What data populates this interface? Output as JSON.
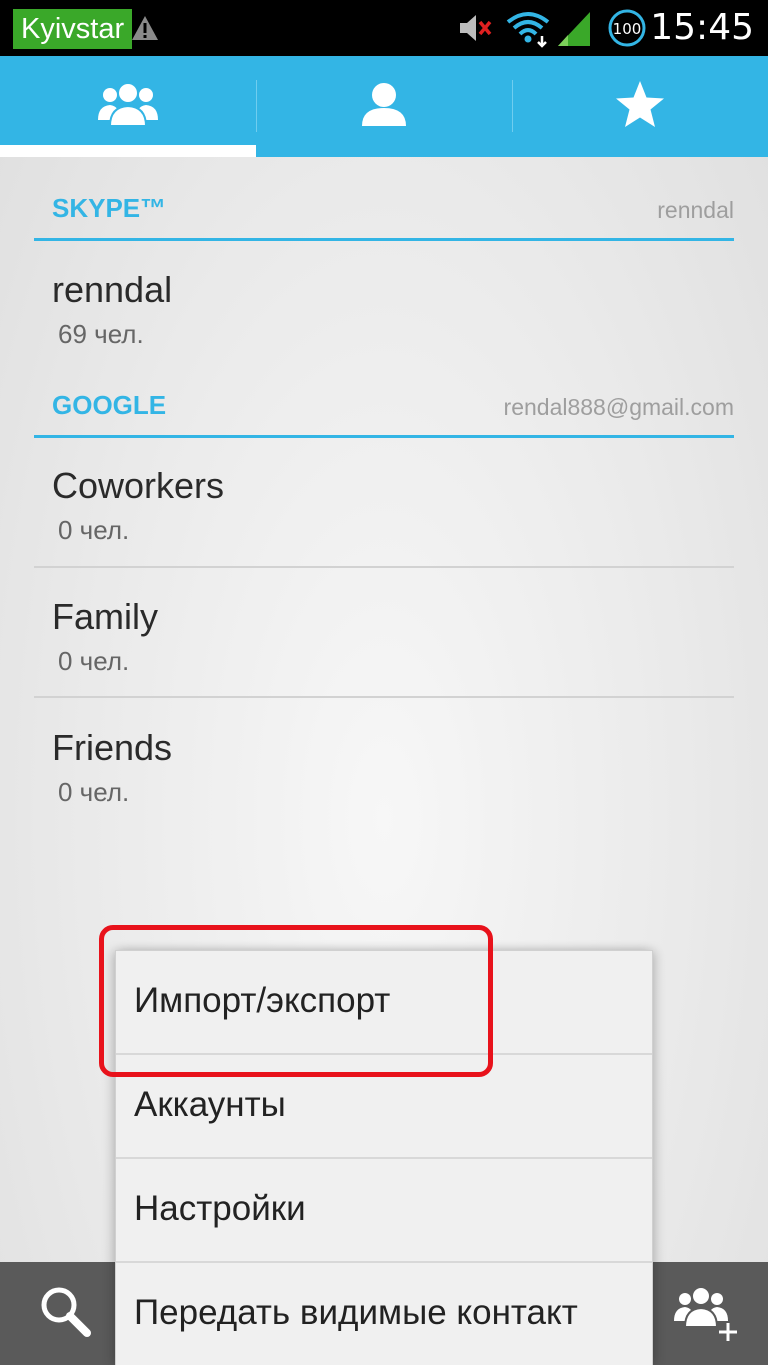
{
  "status_bar": {
    "carrier": "Kyivstar",
    "battery": "100",
    "time": "15:45",
    "icons": [
      "warning-icon",
      "mute-icon",
      "wifi-icon",
      "signal-icon",
      "battery-icon"
    ]
  },
  "tabs": [
    {
      "name": "groups",
      "icon": "groups-icon",
      "selected": true
    },
    {
      "name": "contacts",
      "icon": "person-icon",
      "selected": false
    },
    {
      "name": "favorites",
      "icon": "star-icon",
      "selected": false
    }
  ],
  "accounts": [
    {
      "name": "SKYPE™",
      "user": "renndal",
      "groups": [
        {
          "name": "renndal",
          "count": "69 чел."
        }
      ]
    },
    {
      "name": "GOOGLE",
      "user": "rendal888@gmail.com",
      "groups": [
        {
          "name": "Coworkers",
          "count": "0 чел."
        },
        {
          "name": "Family",
          "count": "0 чел."
        },
        {
          "name": "Friends",
          "count": "0 чел."
        }
      ]
    }
  ],
  "menu": {
    "items": [
      {
        "label": "Импорт/экспорт",
        "highlighted": true
      },
      {
        "label": "Аккаунты"
      },
      {
        "label": "Настройки"
      },
      {
        "label": "Передать видимые контакт"
      }
    ]
  },
  "bottom_bar": {
    "icons": [
      "search-icon",
      "add-group-icon"
    ]
  },
  "colors": {
    "accent": "#33b5e5",
    "carrier_bg": "#3aa829",
    "highlight": "#e8121b",
    "bottom_bar": "#5a5a5a"
  }
}
